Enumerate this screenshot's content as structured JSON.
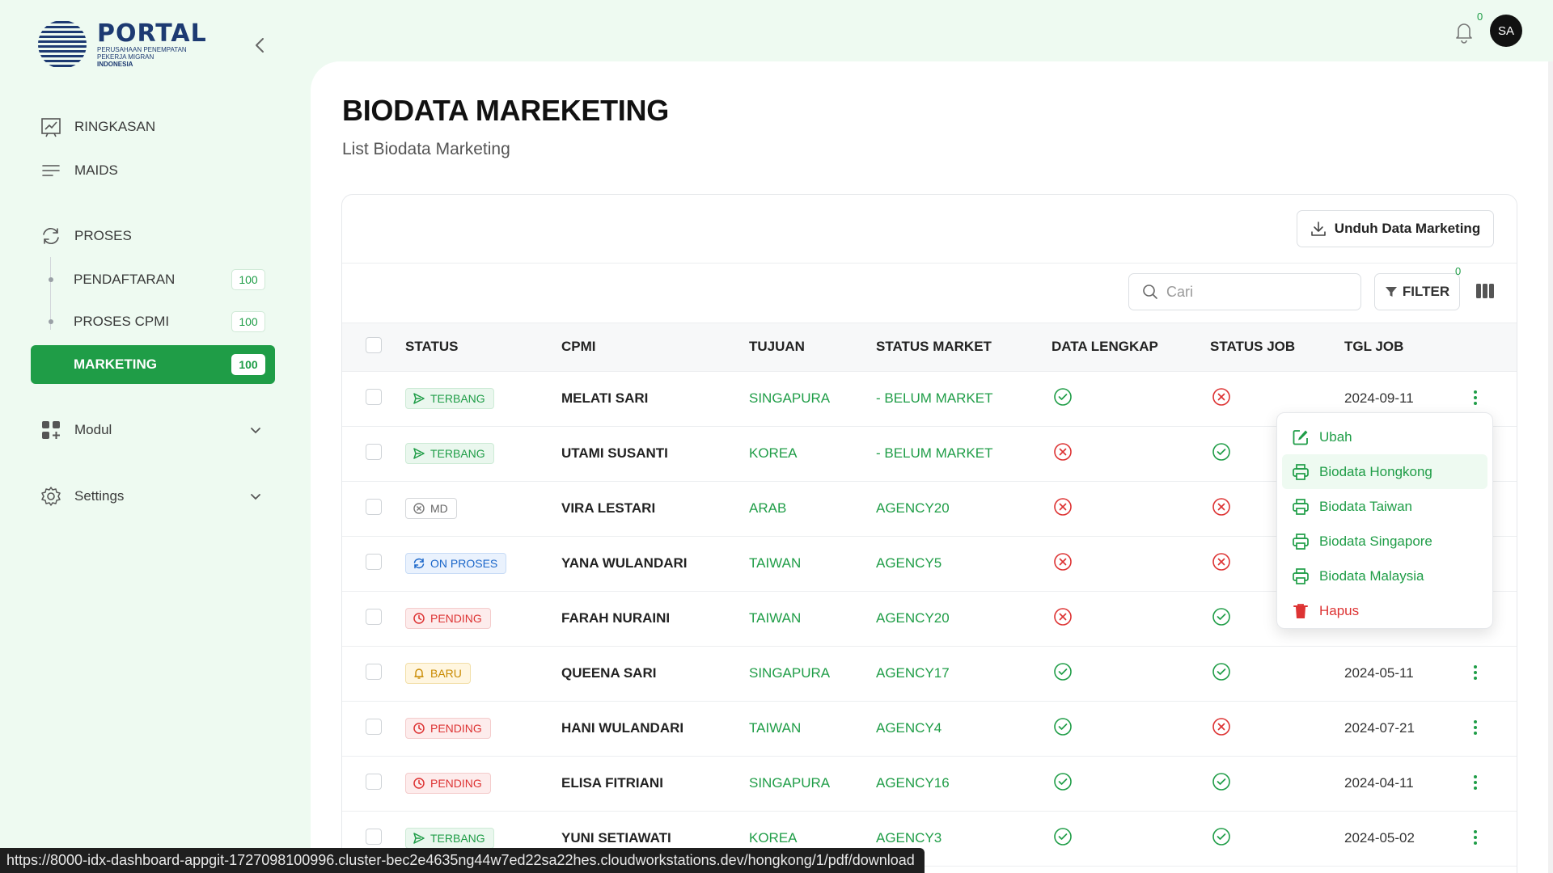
{
  "brand": {
    "title": "PORTAL",
    "sub1": "PERUSAHAAN PENEMPATAN",
    "sub2": "PEKERJA MIGRAN",
    "sub3": "INDONESIA"
  },
  "sidebar": {
    "ringkasan": "RINGKASAN",
    "maids": "MAIDS",
    "proses": "PROSES",
    "sub": [
      {
        "label": "PENDAFTARAN",
        "count": "100"
      },
      {
        "label": "PROSES CPMI",
        "count": "100"
      },
      {
        "label": "MARKETING",
        "count": "100"
      }
    ],
    "modul": "Modul",
    "settings": "Settings"
  },
  "topbar": {
    "notif_count": "0",
    "avatar_initials": "SA"
  },
  "page": {
    "title": "BIODATA MAREKETING",
    "subtitle": "List Biodata Marketing"
  },
  "toolbar": {
    "download_label": "Unduh Data Marketing",
    "search_placeholder": "Cari",
    "filter_label": "FILTER",
    "filter_count": "0"
  },
  "table": {
    "headers": [
      "STATUS",
      "CPMI",
      "TUJUAN",
      "STATUS MARKET",
      "DATA LENGKAP",
      "STATUS JOB",
      "TGL JOB"
    ],
    "rows": [
      {
        "status": "TERBANG",
        "kind": "terbang",
        "cpmi": "MELATI SARI",
        "tujuan": "SINGAPURA",
        "market": "- BELUM MARKET",
        "lengkap": true,
        "job": false,
        "tgl": "2024-09-11"
      },
      {
        "status": "TERBANG",
        "kind": "terbang",
        "cpmi": "UTAMI SUSANTI",
        "tujuan": "KOREA",
        "market": "- BELUM MARKET",
        "lengkap": false,
        "job": true,
        "tgl": ""
      },
      {
        "status": "MD",
        "kind": "md",
        "cpmi": "VIRA LESTARI",
        "tujuan": "ARAB",
        "market": "AGENCY20",
        "lengkap": false,
        "job": false,
        "tgl": ""
      },
      {
        "status": "ON PROSES",
        "kind": "proses",
        "cpmi": "YANA WULANDARI",
        "tujuan": "TAIWAN",
        "market": "AGENCY5",
        "lengkap": false,
        "job": false,
        "tgl": ""
      },
      {
        "status": "PENDING",
        "kind": "pending",
        "cpmi": "FARAH NURAINI",
        "tujuan": "TAIWAN",
        "market": "AGENCY20",
        "lengkap": false,
        "job": true,
        "tgl": ""
      },
      {
        "status": "BARU",
        "kind": "baru",
        "cpmi": "QUEENA SARI",
        "tujuan": "SINGAPURA",
        "market": "AGENCY17",
        "lengkap": true,
        "job": true,
        "tgl": "2024-05-11"
      },
      {
        "status": "PENDING",
        "kind": "pending",
        "cpmi": "HANI WULANDARI",
        "tujuan": "TAIWAN",
        "market": "AGENCY4",
        "lengkap": true,
        "job": false,
        "tgl": "2024-07-21"
      },
      {
        "status": "PENDING",
        "kind": "pending",
        "cpmi": "ELISA FITRIANI",
        "tujuan": "SINGAPURA",
        "market": "AGENCY16",
        "lengkap": true,
        "job": true,
        "tgl": "2024-04-11"
      },
      {
        "status": "TERBANG",
        "kind": "terbang",
        "cpmi": "YUNI SETIAWATI",
        "tujuan": "KOREA",
        "market": "AGENCY3",
        "lengkap": true,
        "job": true,
        "tgl": "2024-05-02"
      }
    ]
  },
  "menu": {
    "items": [
      "Ubah",
      "Biodata Hongkong",
      "Biodata Taiwan",
      "Biodata Singapore",
      "Biodata Malaysia",
      "Hapus"
    ]
  },
  "status_url": "https://8000-idx-dashboard-appgit-1727098100996.cluster-bec2e4635ng44w7ed22sa22hes.cloudworkstations.dev/hongkong/1/pdf/download",
  "colors": {
    "brand_green": "#1f9d47",
    "danger_red": "#dd3333",
    "navy": "#1d3a72"
  }
}
